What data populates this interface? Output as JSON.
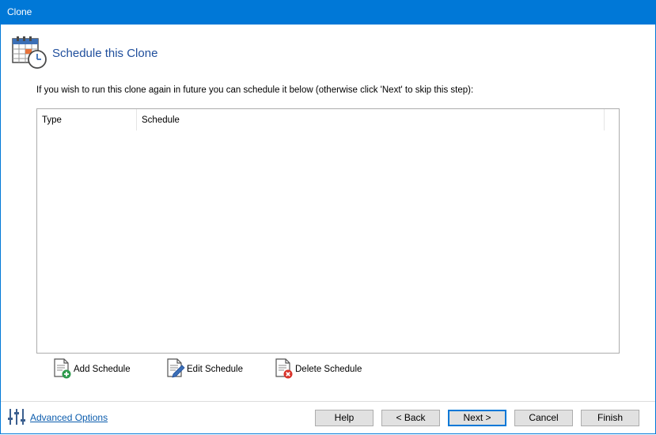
{
  "window": {
    "title": "Clone"
  },
  "header": {
    "title": "Schedule this Clone",
    "icon": "calendar-clock-icon"
  },
  "instruction": "If you wish to run this clone again in future you can schedule it below (otherwise click 'Next' to skip this step):",
  "schedule_list": {
    "columns": [
      "Type",
      "Schedule"
    ],
    "rows": []
  },
  "actions": {
    "add": "Add Schedule",
    "edit": "Edit Schedule",
    "delete": "Delete Schedule"
  },
  "footer": {
    "advanced_options": "Advanced Options",
    "help": "Help",
    "back": "< Back",
    "next": "Next >",
    "cancel": "Cancel",
    "finish": "Finish"
  },
  "colors": {
    "title_bar": "#0078d7",
    "heading": "#1f4e9c",
    "link": "#0b5cad"
  }
}
